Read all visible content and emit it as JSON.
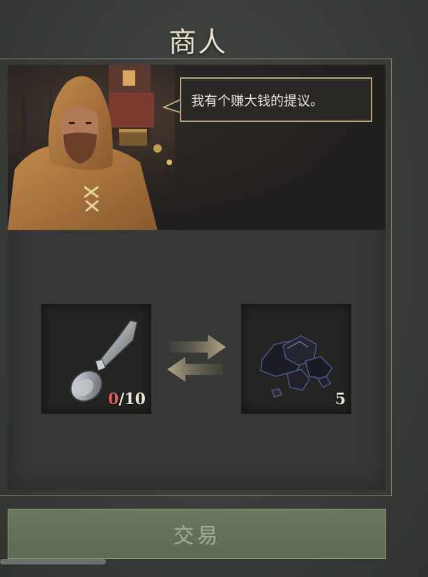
{
  "header": {
    "title": "商人"
  },
  "merchant": {
    "dialogue": "我有个赚大钱的提议。"
  },
  "trade": {
    "give": {
      "icon": "spoon-icon",
      "have": "0",
      "need": "/10"
    },
    "receive": {
      "icon": "coal-icon",
      "quantity": "5"
    },
    "button_label": "交易"
  },
  "colors": {
    "accent_gold": "#b9a780",
    "shortfall_red": "#d7625c",
    "button_green": "#5c6a52"
  }
}
